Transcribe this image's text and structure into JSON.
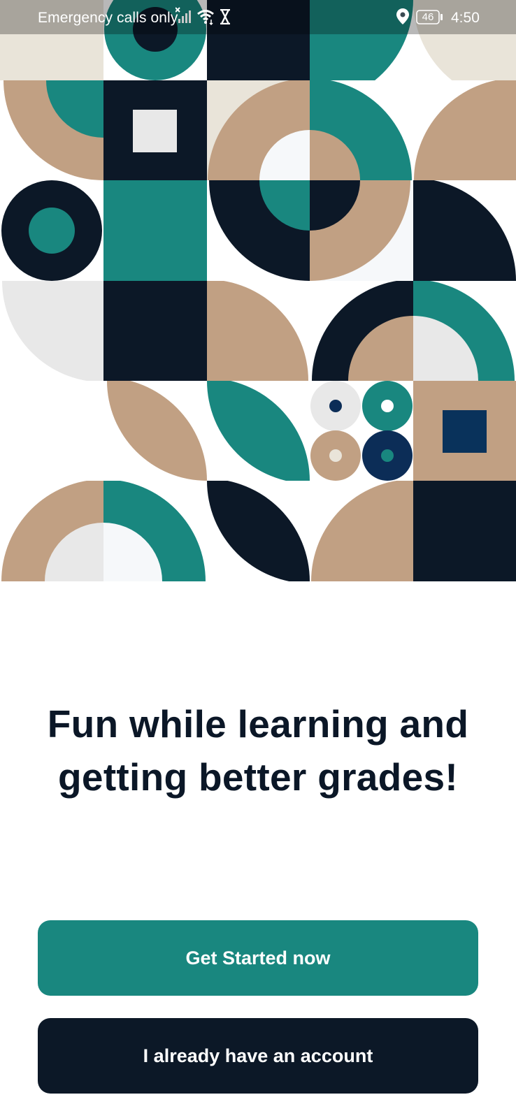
{
  "status_bar": {
    "carrier": "Emergency calls only",
    "battery": "46",
    "time": "4:50",
    "icons": [
      "no-sim-signal-icon",
      "wifi-icon",
      "hourglass-icon",
      "location-icon",
      "battery-icon"
    ]
  },
  "onboarding": {
    "headline": "Fun while learning and getting better grades!",
    "primary_button": "Get Started now",
    "secondary_button": "I already have an account"
  },
  "colors": {
    "teal": "#19877f",
    "navy": "#0c1827",
    "tan": "#c1a083",
    "cream": "#e9e4d9",
    "light_gray": "#e8e8e8",
    "off_white": "#f6f8fa",
    "deep_blue": "#09325b",
    "background": "#ffffff"
  }
}
